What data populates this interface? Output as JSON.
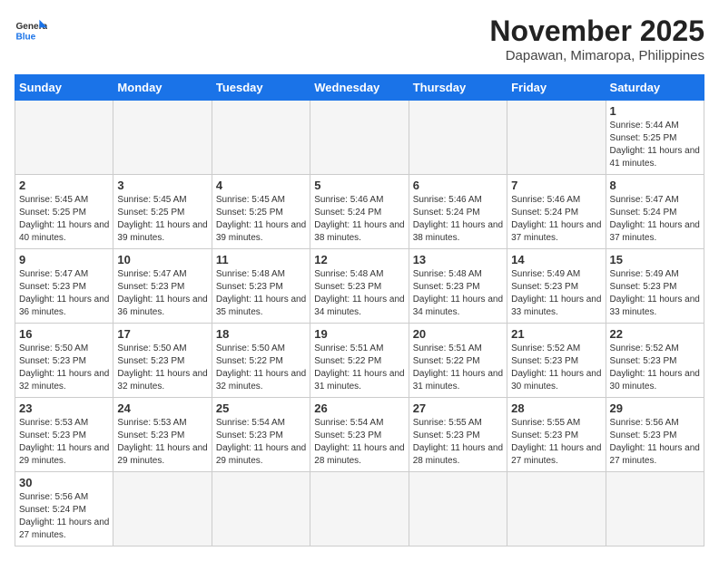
{
  "header": {
    "logo_general": "General",
    "logo_blue": "Blue",
    "month_title": "November 2025",
    "location": "Dapawan, Mimaropa, Philippines"
  },
  "weekdays": [
    "Sunday",
    "Monday",
    "Tuesday",
    "Wednesday",
    "Thursday",
    "Friday",
    "Saturday"
  ],
  "days": [
    {
      "date": "",
      "info": ""
    },
    {
      "date": "",
      "info": ""
    },
    {
      "date": "",
      "info": ""
    },
    {
      "date": "",
      "info": ""
    },
    {
      "date": "",
      "info": ""
    },
    {
      "date": "",
      "info": ""
    },
    {
      "date": "1",
      "sunrise": "Sunrise: 5:44 AM",
      "sunset": "Sunset: 5:25 PM",
      "daylight": "Daylight: 11 hours and 41 minutes."
    },
    {
      "date": "2",
      "sunrise": "Sunrise: 5:45 AM",
      "sunset": "Sunset: 5:25 PM",
      "daylight": "Daylight: 11 hours and 40 minutes."
    },
    {
      "date": "3",
      "sunrise": "Sunrise: 5:45 AM",
      "sunset": "Sunset: 5:25 PM",
      "daylight": "Daylight: 11 hours and 39 minutes."
    },
    {
      "date": "4",
      "sunrise": "Sunrise: 5:45 AM",
      "sunset": "Sunset: 5:25 PM",
      "daylight": "Daylight: 11 hours and 39 minutes."
    },
    {
      "date": "5",
      "sunrise": "Sunrise: 5:46 AM",
      "sunset": "Sunset: 5:24 PM",
      "daylight": "Daylight: 11 hours and 38 minutes."
    },
    {
      "date": "6",
      "sunrise": "Sunrise: 5:46 AM",
      "sunset": "Sunset: 5:24 PM",
      "daylight": "Daylight: 11 hours and 38 minutes."
    },
    {
      "date": "7",
      "sunrise": "Sunrise: 5:46 AM",
      "sunset": "Sunset: 5:24 PM",
      "daylight": "Daylight: 11 hours and 37 minutes."
    },
    {
      "date": "8",
      "sunrise": "Sunrise: 5:47 AM",
      "sunset": "Sunset: 5:24 PM",
      "daylight": "Daylight: 11 hours and 37 minutes."
    },
    {
      "date": "9",
      "sunrise": "Sunrise: 5:47 AM",
      "sunset": "Sunset: 5:23 PM",
      "daylight": "Daylight: 11 hours and 36 minutes."
    },
    {
      "date": "10",
      "sunrise": "Sunrise: 5:47 AM",
      "sunset": "Sunset: 5:23 PM",
      "daylight": "Daylight: 11 hours and 36 minutes."
    },
    {
      "date": "11",
      "sunrise": "Sunrise: 5:48 AM",
      "sunset": "Sunset: 5:23 PM",
      "daylight": "Daylight: 11 hours and 35 minutes."
    },
    {
      "date": "12",
      "sunrise": "Sunrise: 5:48 AM",
      "sunset": "Sunset: 5:23 PM",
      "daylight": "Daylight: 11 hours and 34 minutes."
    },
    {
      "date": "13",
      "sunrise": "Sunrise: 5:48 AM",
      "sunset": "Sunset: 5:23 PM",
      "daylight": "Daylight: 11 hours and 34 minutes."
    },
    {
      "date": "14",
      "sunrise": "Sunrise: 5:49 AM",
      "sunset": "Sunset: 5:23 PM",
      "daylight": "Daylight: 11 hours and 33 minutes."
    },
    {
      "date": "15",
      "sunrise": "Sunrise: 5:49 AM",
      "sunset": "Sunset: 5:23 PM",
      "daylight": "Daylight: 11 hours and 33 minutes."
    },
    {
      "date": "16",
      "sunrise": "Sunrise: 5:50 AM",
      "sunset": "Sunset: 5:23 PM",
      "daylight": "Daylight: 11 hours and 32 minutes."
    },
    {
      "date": "17",
      "sunrise": "Sunrise: 5:50 AM",
      "sunset": "Sunset: 5:23 PM",
      "daylight": "Daylight: 11 hours and 32 minutes."
    },
    {
      "date": "18",
      "sunrise": "Sunrise: 5:50 AM",
      "sunset": "Sunset: 5:22 PM",
      "daylight": "Daylight: 11 hours and 32 minutes."
    },
    {
      "date": "19",
      "sunrise": "Sunrise: 5:51 AM",
      "sunset": "Sunset: 5:22 PM",
      "daylight": "Daylight: 11 hours and 31 minutes."
    },
    {
      "date": "20",
      "sunrise": "Sunrise: 5:51 AM",
      "sunset": "Sunset: 5:22 PM",
      "daylight": "Daylight: 11 hours and 31 minutes."
    },
    {
      "date": "21",
      "sunrise": "Sunrise: 5:52 AM",
      "sunset": "Sunset: 5:23 PM",
      "daylight": "Daylight: 11 hours and 30 minutes."
    },
    {
      "date": "22",
      "sunrise": "Sunrise: 5:52 AM",
      "sunset": "Sunset: 5:23 PM",
      "daylight": "Daylight: 11 hours and 30 minutes."
    },
    {
      "date": "23",
      "sunrise": "Sunrise: 5:53 AM",
      "sunset": "Sunset: 5:23 PM",
      "daylight": "Daylight: 11 hours and 29 minutes."
    },
    {
      "date": "24",
      "sunrise": "Sunrise: 5:53 AM",
      "sunset": "Sunset: 5:23 PM",
      "daylight": "Daylight: 11 hours and 29 minutes."
    },
    {
      "date": "25",
      "sunrise": "Sunrise: 5:54 AM",
      "sunset": "Sunset: 5:23 PM",
      "daylight": "Daylight: 11 hours and 29 minutes."
    },
    {
      "date": "26",
      "sunrise": "Sunrise: 5:54 AM",
      "sunset": "Sunset: 5:23 PM",
      "daylight": "Daylight: 11 hours and 28 minutes."
    },
    {
      "date": "27",
      "sunrise": "Sunrise: 5:55 AM",
      "sunset": "Sunset: 5:23 PM",
      "daylight": "Daylight: 11 hours and 28 minutes."
    },
    {
      "date": "28",
      "sunrise": "Sunrise: 5:55 AM",
      "sunset": "Sunset: 5:23 PM",
      "daylight": "Daylight: 11 hours and 27 minutes."
    },
    {
      "date": "29",
      "sunrise": "Sunrise: 5:56 AM",
      "sunset": "Sunset: 5:23 PM",
      "daylight": "Daylight: 11 hours and 27 minutes."
    },
    {
      "date": "30",
      "sunrise": "Sunrise: 5:56 AM",
      "sunset": "Sunset: 5:24 PM",
      "daylight": "Daylight: 11 hours and 27 minutes."
    }
  ]
}
